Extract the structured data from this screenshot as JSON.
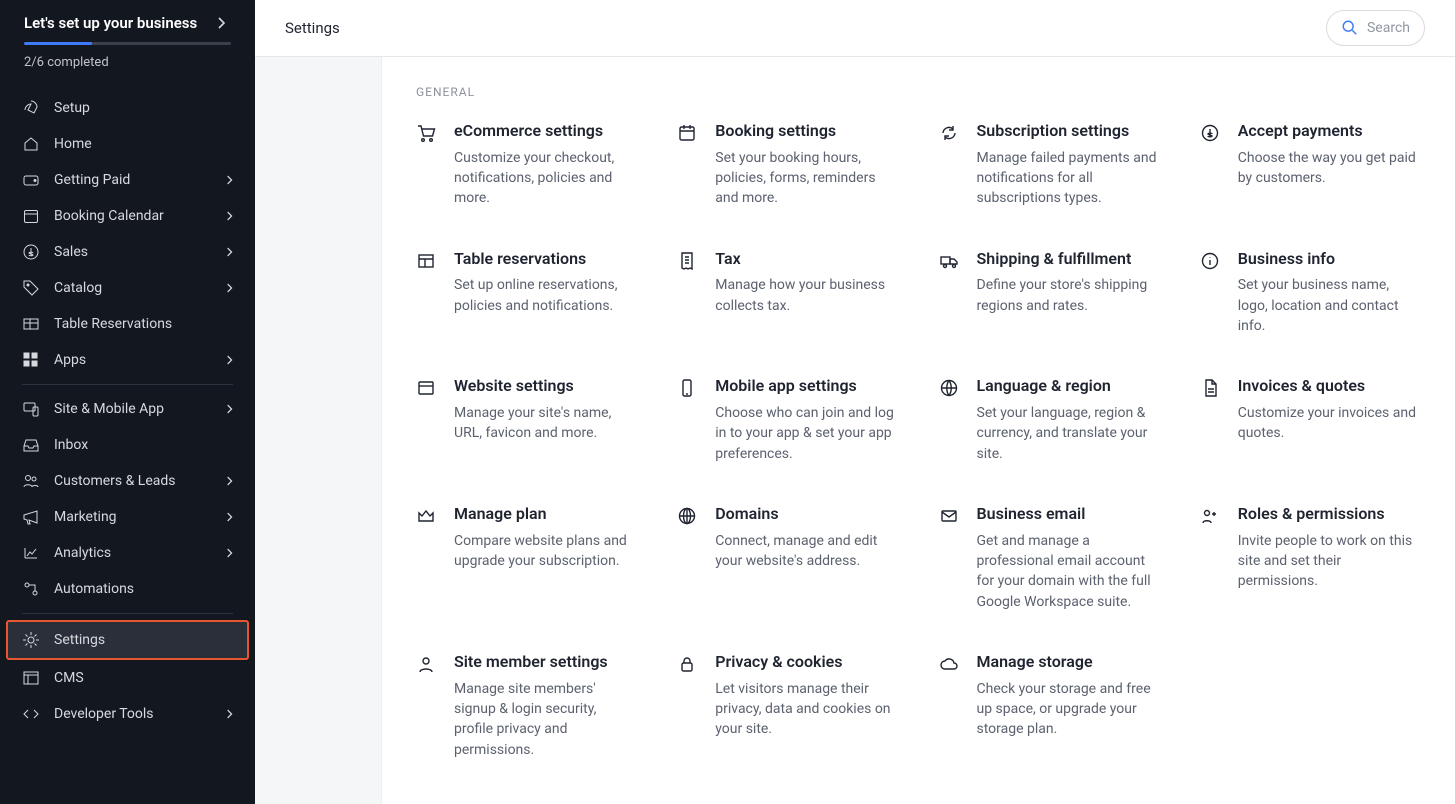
{
  "sidebar": {
    "setup": {
      "title": "Let's set up your business",
      "progress_pct": 33,
      "meta": "2/6 completed"
    },
    "items": [
      {
        "icon": "rocket",
        "label": "Setup",
        "chev": false
      },
      {
        "icon": "home",
        "label": "Home",
        "chev": false
      },
      {
        "icon": "wallet",
        "label": "Getting Paid",
        "chev": true
      },
      {
        "icon": "calendar",
        "label": "Booking Calendar",
        "chev": true
      },
      {
        "icon": "dollar",
        "label": "Sales",
        "chev": true
      },
      {
        "icon": "tag",
        "label": "Catalog",
        "chev": true
      },
      {
        "icon": "table",
        "label": "Table Reservations",
        "chev": false
      },
      {
        "icon": "grid",
        "label": "Apps",
        "chev": true
      },
      {
        "sep": true
      },
      {
        "icon": "device",
        "label": "Site & Mobile App",
        "chev": true
      },
      {
        "icon": "inbox",
        "label": "Inbox",
        "chev": false
      },
      {
        "icon": "people",
        "label": "Customers & Leads",
        "chev": true
      },
      {
        "icon": "mega",
        "label": "Marketing",
        "chev": true
      },
      {
        "icon": "chart",
        "label": "Analytics",
        "chev": true
      },
      {
        "icon": "auto",
        "label": "Automations",
        "chev": false
      },
      {
        "sep": true
      },
      {
        "icon": "gear",
        "label": "Settings",
        "chev": false,
        "active": true
      },
      {
        "icon": "cms",
        "label": "CMS",
        "chev": false
      },
      {
        "icon": "code",
        "label": "Developer Tools",
        "chev": true
      }
    ]
  },
  "topbar": {
    "title": "Settings",
    "search_placeholder": "Search"
  },
  "section_heads": {
    "general": "GENERAL"
  },
  "tiles": [
    {
      "icon": "cart",
      "title": "eCommerce settings",
      "desc": "Customize your checkout, notifications, policies and more."
    },
    {
      "icon": "cal",
      "title": "Booking settings",
      "desc": "Set your booking hours, policies, forms, reminders and more."
    },
    {
      "icon": "refresh",
      "title": "Subscription settings",
      "desc": "Manage failed payments and notifications for all subscriptions types."
    },
    {
      "icon": "coin",
      "title": "Accept payments",
      "desc": "Choose the way you get paid by customers."
    },
    {
      "icon": "layout",
      "title": "Table reservations",
      "desc": "Set up online reservations, policies and notifications."
    },
    {
      "icon": "receipt",
      "title": "Tax",
      "desc": "Manage how your business collects tax."
    },
    {
      "icon": "truck",
      "title": "Shipping & fulfillment",
      "desc": "Define your store's shipping regions and rates."
    },
    {
      "icon": "info",
      "title": "Business info",
      "desc": "Set your business name, logo, location and contact info."
    },
    {
      "icon": "window",
      "title": "Website settings",
      "desc": "Manage your site's name, URL, favicon and more."
    },
    {
      "icon": "phone",
      "title": "Mobile app settings",
      "desc": "Choose who can join and log in to your app & set your app preferences."
    },
    {
      "icon": "globe",
      "title": "Language & region",
      "desc": "Set your language, region & currency, and translate your site."
    },
    {
      "icon": "doc",
      "title": "Invoices & quotes",
      "desc": "Customize your invoices and quotes."
    },
    {
      "icon": "crown",
      "title": "Manage plan",
      "desc": "Compare website plans and upgrade your subscription."
    },
    {
      "icon": "globe2",
      "title": "Domains",
      "desc": "Connect, manage and edit your website's address."
    },
    {
      "icon": "mail",
      "title": "Business email",
      "desc": "Get and manage a professional email account for your domain with the full Google Workspace suite."
    },
    {
      "icon": "roles",
      "title": "Roles & permissions",
      "desc": "Invite people to work on this site and set their permissions."
    },
    {
      "icon": "person",
      "title": "Site member settings",
      "desc": "Manage site members' signup & login security, profile privacy and permissions."
    },
    {
      "icon": "lock",
      "title": "Privacy & cookies",
      "desc": "Let visitors manage their privacy, data and cookies on your site."
    },
    {
      "icon": "cloud",
      "title": "Manage storage",
      "desc": "Check your storage and free up space, or upgrade your storage plan."
    }
  ]
}
